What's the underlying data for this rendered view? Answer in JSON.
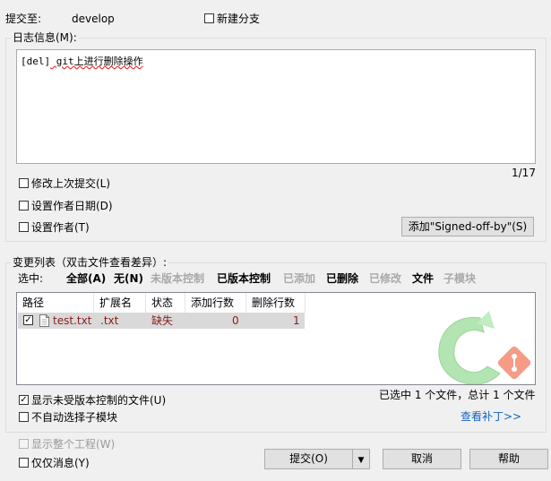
{
  "commit_to": {
    "label": "提交至:",
    "branch": "develop"
  },
  "new_branch": {
    "label": "新建分支",
    "checked": false
  },
  "log": {
    "group_label": "日志信息(M):",
    "message_tag": "[del]",
    "message_body": " git上进行删除操作",
    "line_counter": "1/17"
  },
  "options": {
    "amend": {
      "label": "修改上次提交(L)",
      "checked": false
    },
    "set_date": {
      "label": "设置作者日期(D)",
      "checked": false
    },
    "set_author": {
      "label": "设置作者(T)",
      "checked": false
    }
  },
  "signed_off_button": "添加\"Signed-off-by\"(S)",
  "changes": {
    "group_label": "变更列表（双击文件查看差异）:",
    "select_label": "选中:",
    "filters": {
      "all": "全部(A)",
      "none": "无(N)",
      "unversioned": "未版本控制",
      "versioned": "已版本控制",
      "added": "已添加",
      "deleted": "已删除",
      "modified": "已修改",
      "files": "文件",
      "submodules": "子模块"
    },
    "columns": [
      "路径",
      "扩展名",
      "状态",
      "添加行数",
      "删除行数"
    ],
    "rows": [
      {
        "checked": true,
        "path": "test.txt",
        "ext": ".txt",
        "status": "缺失",
        "added": "0",
        "deleted": "1"
      }
    ]
  },
  "show_unversioned": {
    "label": "显示未受版本控制的文件(U)",
    "checked": true
  },
  "no_auto_submodule": {
    "label": "不自动选择子模块",
    "checked": false
  },
  "selection_summary": "已选中 1 个文件，总计 1 个文件",
  "view_patch_link": "查看补丁>>",
  "show_whole_project": {
    "label": "显示整个工程(W)",
    "checked": false,
    "disabled": true
  },
  "message_only": {
    "label": "仅仅消息(Y)",
    "checked": false
  },
  "buttons": {
    "commit": "提交(O)",
    "cancel": "取消",
    "help": "帮助"
  },
  "colors": {
    "row_text": "#8b1a1a",
    "link": "#1565c0",
    "watermark_green": "#7fd47f",
    "watermark_orange": "#f05a37"
  },
  "icons": {
    "watermark": "tortoisegit-logo-icon",
    "file": "file-icon",
    "dropdown": "chevron-down-icon"
  }
}
